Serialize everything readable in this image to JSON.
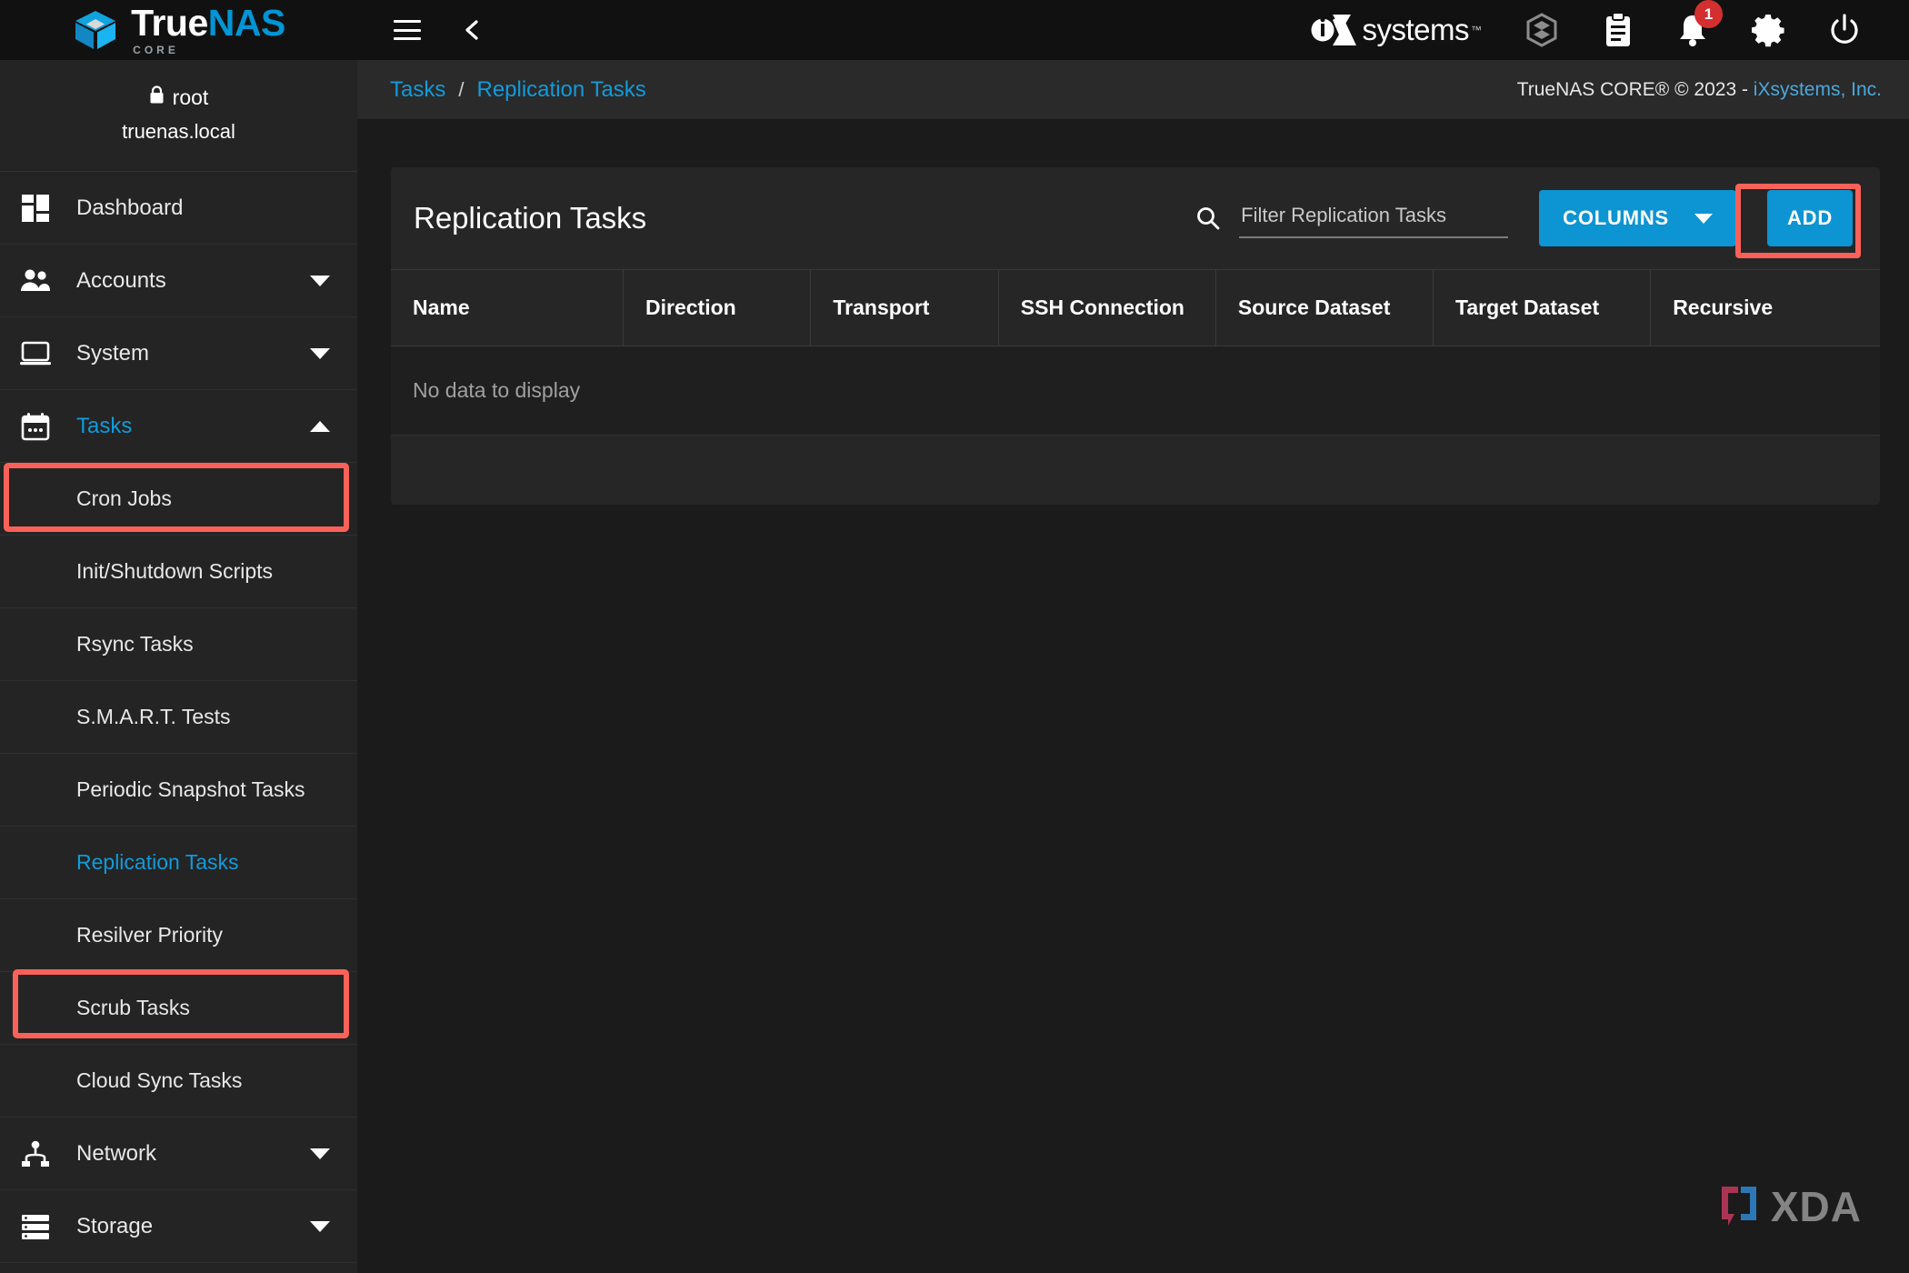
{
  "brand": {
    "name_primary": "True",
    "name_secondary": "NAS",
    "edition": "CORE",
    "logo_icon": "truenas-cube-logo",
    "accent_color": "#0095d5"
  },
  "topbar": {
    "menu_icon": "hamburger-menu-icon",
    "back_icon": "chevron-left-icon",
    "vendor_logo": "ixsystems-logo",
    "vendor_name": "systems",
    "vendor_tm": "™",
    "icons": [
      {
        "name": "jails-cube-icon",
        "label": "Jails"
      },
      {
        "name": "clipboard-tasks-icon",
        "label": "Task Manager"
      },
      {
        "name": "bell-alerts-icon",
        "label": "Alerts",
        "badge": "1"
      },
      {
        "name": "gear-settings-icon",
        "label": "Settings"
      },
      {
        "name": "power-icon",
        "label": "Power"
      }
    ],
    "badge_color": "#d32f2f"
  },
  "sidebar": {
    "user": {
      "lock_icon": "lock-icon",
      "username": "root",
      "hostname": "truenas.local"
    },
    "items": [
      {
        "label": "Dashboard",
        "icon": "dashboard-grid-icon",
        "expandable": false,
        "active": false
      },
      {
        "label": "Accounts",
        "icon": "accounts-people-icon",
        "expandable": true,
        "chevron": "chevron-down-icon",
        "active": false
      },
      {
        "label": "System",
        "icon": "system-monitor-icon",
        "expandable": true,
        "chevron": "chevron-down-icon",
        "active": false
      },
      {
        "label": "Tasks",
        "icon": "tasks-calendar-icon",
        "expandable": true,
        "chevron": "chevron-up-icon",
        "active": true
      },
      {
        "label": "Network",
        "icon": "network-hierarchy-icon",
        "expandable": true,
        "chevron": "chevron-down-icon",
        "active": false
      },
      {
        "label": "Storage",
        "icon": "storage-stack-icon",
        "expandable": true,
        "chevron": "chevron-down-icon",
        "active": false
      }
    ],
    "task_subitems": [
      {
        "label": "Cron Jobs",
        "active": false
      },
      {
        "label": "Init/Shutdown Scripts",
        "active": false
      },
      {
        "label": "Rsync Tasks",
        "active": false
      },
      {
        "label": "S.M.A.R.T. Tests",
        "active": false
      },
      {
        "label": "Periodic Snapshot Tasks",
        "active": false
      },
      {
        "label": "Replication Tasks",
        "active": true
      },
      {
        "label": "Resilver Priority",
        "active": false
      },
      {
        "label": "Scrub Tasks",
        "active": false
      },
      {
        "label": "Cloud Sync Tasks",
        "active": false
      }
    ],
    "active_color": "#0f9bdb"
  },
  "breadcrumb": {
    "items": [
      "Tasks",
      "Replication Tasks"
    ],
    "separator": "/",
    "link_color": "#0f9bdb"
  },
  "footer_note": {
    "product": "TrueNAS CORE® © 2023 - ",
    "company": "iXsystems, Inc.",
    "company_color": "#4aa8dd"
  },
  "card": {
    "title": "Replication Tasks",
    "search": {
      "icon": "search-icon",
      "placeholder": "Filter Replication Tasks",
      "value": ""
    },
    "columns_button": {
      "label": "COLUMNS",
      "caret_icon": "caret-down-icon",
      "color": "#0d94d2"
    },
    "add_button": {
      "label": "ADD",
      "color": "#0d94d2"
    },
    "table": {
      "headers": [
        "Name",
        "Direction",
        "Transport",
        "SSH Connection",
        "Source Dataset",
        "Target Dataset",
        "Recursive"
      ],
      "rows": [],
      "empty_message": "No data to display"
    }
  },
  "annotations": {
    "highlight_color": "#fa6259",
    "boxes": [
      "tasks-nav-item",
      "replication-tasks-nav-item",
      "add-button"
    ]
  },
  "watermark": {
    "text": "XDA",
    "mark_icon": "xda-bracket-logo",
    "left_color": "#b8375a",
    "right_color": "#2f7fc4"
  }
}
